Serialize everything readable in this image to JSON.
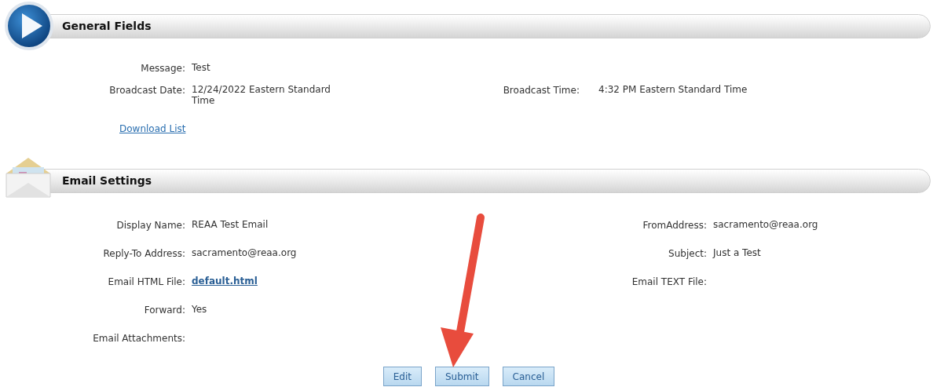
{
  "sections": [
    {
      "title": "General Fields",
      "kind": "play",
      "rows": [
        {
          "left": {
            "label": "Message:",
            "value": "Test"
          }
        },
        {
          "left": {
            "label": "Broadcast Date:",
            "value": "12/24/2022 Eastern Standard Time"
          },
          "right": {
            "label": "Broadcast Time:",
            "value": "4:32 PM Eastern Standard Time"
          }
        }
      ],
      "links": [
        "Download List"
      ]
    },
    {
      "title": "Email Settings",
      "kind": "envelope",
      "rows": [
        {
          "left": {
            "label": "Display Name:",
            "value": "REAA Test Email"
          },
          "right": {
            "label": "FromAddress:",
            "value": "sacramento@reaa.org"
          }
        },
        {
          "left": {
            "label": "Reply-To Address:",
            "value": "sacramento@reaa.org"
          },
          "right": {
            "label": "Subject:",
            "value": "Just a Test"
          }
        },
        {
          "left": {
            "label": "Email HTML File:",
            "value": "default.html",
            "kind": "link"
          },
          "right": {
            "label": "Email TEXT File:"
          }
        },
        {
          "left": {
            "label": "Forward:",
            "value": "Yes"
          }
        },
        {
          "left": {
            "label": "Email Attachments:"
          }
        }
      ]
    }
  ],
  "buttons": [
    "Edit",
    "Submit",
    "Cancel"
  ]
}
